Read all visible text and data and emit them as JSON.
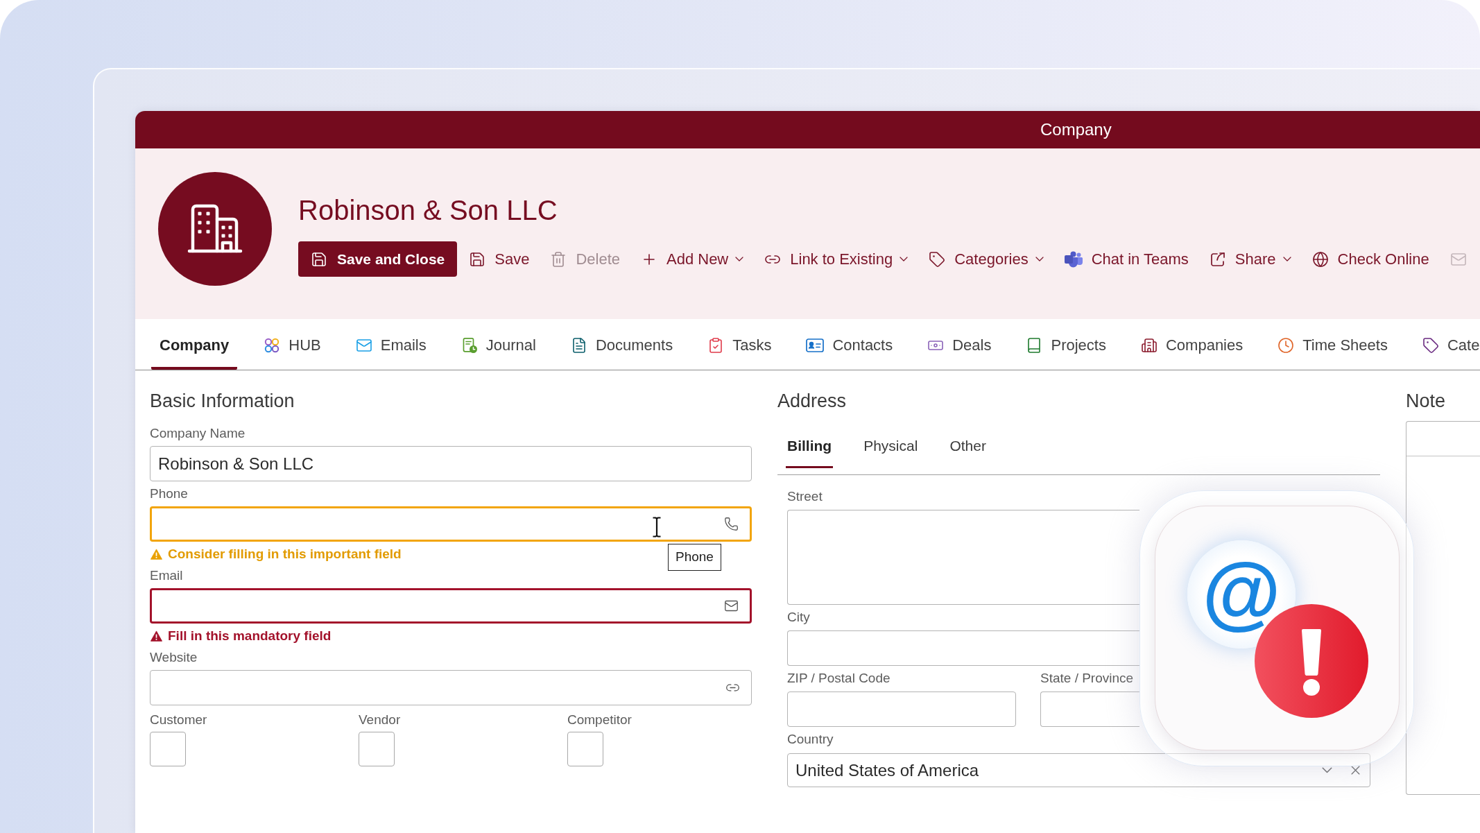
{
  "window": {
    "title": "Company"
  },
  "header": {
    "name": "Robinson & Son LLC"
  },
  "toolbar": [
    {
      "kind": "primary",
      "label": "Save and Close",
      "disabled": false
    },
    {
      "kind": "plain",
      "label": "Save",
      "disabled": false
    },
    {
      "kind": "plain",
      "label": "Delete",
      "disabled": true
    },
    {
      "kind": "menu",
      "label": "Add New",
      "disabled": false
    },
    {
      "kind": "menu",
      "label": "Link to Existing",
      "disabled": false
    },
    {
      "kind": "menu",
      "label": "Categories",
      "disabled": false
    },
    {
      "kind": "plain",
      "label": "Chat in Teams",
      "disabled": false
    },
    {
      "kind": "menu",
      "label": "Share",
      "disabled": false
    },
    {
      "kind": "plain",
      "label": "Check Online",
      "disabled": false
    },
    {
      "kind": "icon",
      "disabled": true
    }
  ],
  "tabs": [
    {
      "label": "Company",
      "selected": true
    },
    {
      "label": "HUB",
      "selected": false
    },
    {
      "label": "Emails",
      "selected": false
    },
    {
      "label": "Journal",
      "selected": false
    },
    {
      "label": "Documents",
      "selected": false
    },
    {
      "label": "Tasks",
      "selected": false
    },
    {
      "label": "Contacts",
      "selected": false
    },
    {
      "label": "Deals",
      "selected": false
    },
    {
      "label": "Projects",
      "selected": false
    },
    {
      "label": "Companies",
      "selected": false
    },
    {
      "label": "Time Sheets",
      "selected": false
    },
    {
      "label": "Cate",
      "selected": false
    }
  ],
  "basic_information": {
    "title": "Basic Information",
    "fields": [
      {
        "kind": "text",
        "label": "Company Name",
        "value": "Robinson & Son LLC"
      },
      {
        "kind": "warning",
        "label": "Phone",
        "message": "Consider filling in this important field",
        "tooltip": "Phone"
      },
      {
        "kind": "error",
        "label": "Email",
        "message": "Fill in this mandatory field"
      },
      {
        "kind": "text",
        "label": "Website"
      }
    ],
    "checkboxes": [
      {
        "label": "Customer",
        "checked": false
      },
      {
        "label": "Vendor",
        "checked": false
      },
      {
        "label": "Competitor",
        "checked": false
      }
    ]
  },
  "address": {
    "title": "Address",
    "tabs": [
      {
        "label": "Billing",
        "selected": true
      },
      {
        "label": "Physical",
        "selected": false
      },
      {
        "label": "Other",
        "selected": false
      }
    ],
    "rows": [
      [
        {
          "kind": "textarea",
          "label": "Street"
        }
      ],
      [
        {
          "kind": "text",
          "label": "City"
        }
      ],
      [
        {
          "kind": "text",
          "label": "ZIP / Postal Code"
        },
        {
          "kind": "text",
          "label": "State / Province"
        }
      ],
      [
        {
          "kind": "select",
          "label": "Country",
          "value": "United States of America"
        }
      ]
    ]
  },
  "note": {
    "title": "Note"
  },
  "overlay": {
    "symbol": "@"
  }
}
